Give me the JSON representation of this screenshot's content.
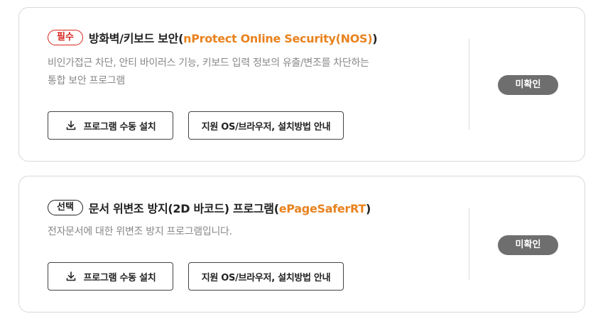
{
  "items": [
    {
      "badge": "필수",
      "title": "방화벽/키보드 보안(",
      "title_accent": "nProtect Online Security(NOS)",
      "title_end": ")",
      "desc_line1": "비인가접근 차단, 안티 바이러스 기능, 키보드 입력 정보의 유출/변조를 차단하는",
      "desc_line2": "통합 보안 프로그램",
      "install_label": "프로그램 수동 설치",
      "guide_label": "지원 OS/브라우저, 설치방법 안내",
      "status": "미확인"
    },
    {
      "badge": "선택",
      "title": "문서 위변조 방지(2D 바코드) 프로그램(",
      "title_accent": "ePageSaferRT",
      "title_end": ")",
      "desc_line1": "전자문서에 대한 위변조 방지 프로그램입니다.",
      "install_label": "프로그램 수동 설치",
      "guide_label": "지원 OS/브라우저, 설치방법 안내",
      "status": "미확인"
    }
  ],
  "colors": {
    "accent": "#e8821e",
    "required_badge": "#d7261e",
    "status_bg": "#6e6e6e"
  },
  "icons": {
    "install": "download-icon"
  }
}
